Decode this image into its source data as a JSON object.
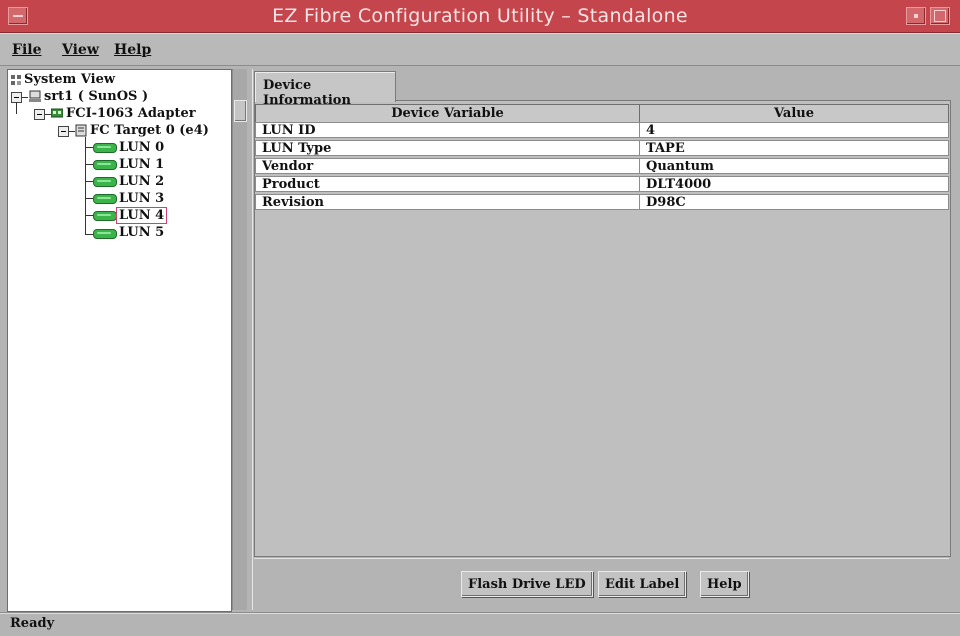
{
  "window": {
    "title": "EZ Fibre Configuration Utility – Standalone"
  },
  "menubar": {
    "items": [
      "File",
      "View",
      "Help"
    ]
  },
  "tree": {
    "root": "System View",
    "host": "srt1 ( SunOS )",
    "adapter": "FCI-1063 Adapter",
    "target": "FC Target 0 (e4)",
    "luns": [
      "LUN 0",
      "LUN 1",
      "LUN 2",
      "LUN 3",
      "LUN 4",
      "LUN 5"
    ],
    "selected_lun": "LUN 4"
  },
  "tab": {
    "label": "Device Information"
  },
  "table": {
    "headers": [
      "Device Variable",
      "Value"
    ],
    "rows": [
      [
        "LUN ID",
        "4"
      ],
      [
        "LUN Type",
        "TAPE"
      ],
      [
        "Vendor",
        "Quantum"
      ],
      [
        "Product",
        "DLT4000"
      ],
      [
        "Revision",
        "D98C"
      ]
    ]
  },
  "buttons": {
    "flash": "Flash Drive LED",
    "edit": "Edit Label",
    "help": "Help"
  },
  "status": {
    "text": "Ready"
  },
  "colors": {
    "titlebar": "#c4464c",
    "lun_icon": "#3bb54a",
    "window_bg": "#b4b4b4"
  }
}
